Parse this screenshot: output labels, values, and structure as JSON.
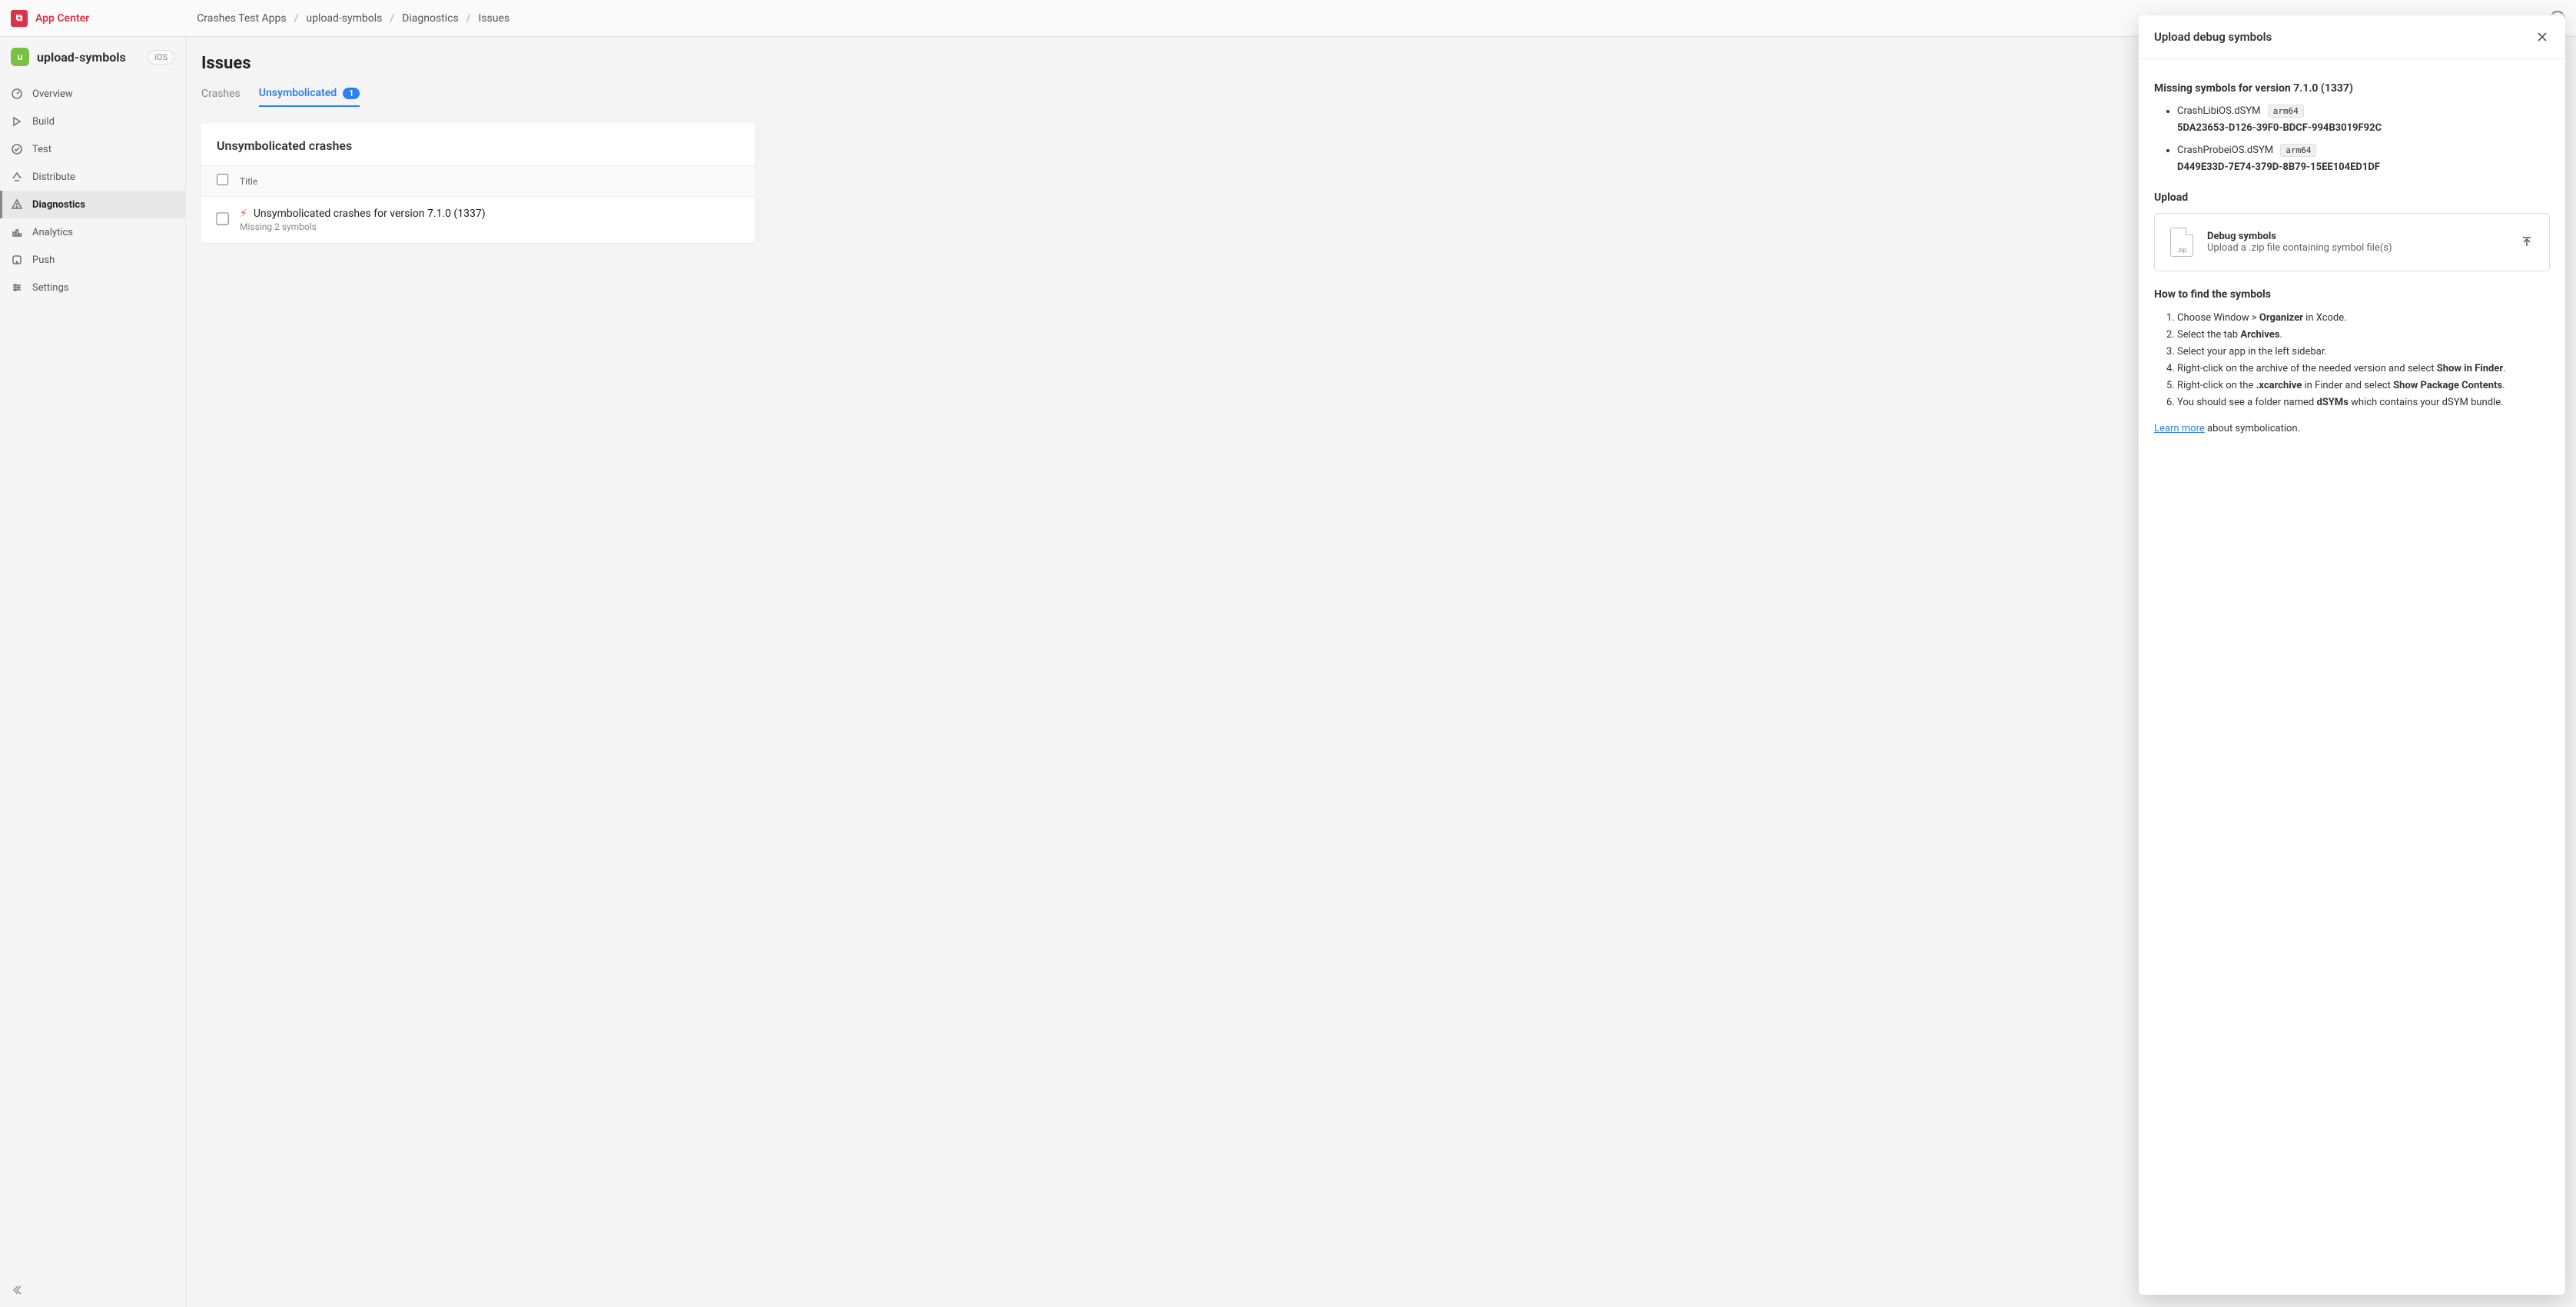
{
  "brand": {
    "logo_letter": "⧉",
    "label": "App Center"
  },
  "breadcrumbs": [
    "Crashes Test Apps",
    "upload-symbols",
    "Diagnostics",
    "Issues"
  ],
  "sidebar": {
    "app_icon_letter": "u",
    "app_name": "upload-symbols",
    "platform": "iOS",
    "items": [
      {
        "label": "Overview"
      },
      {
        "label": "Build"
      },
      {
        "label": "Test"
      },
      {
        "label": "Distribute"
      },
      {
        "label": "Diagnostics",
        "active": true
      },
      {
        "label": "Analytics"
      },
      {
        "label": "Push"
      },
      {
        "label": "Settings"
      }
    ]
  },
  "main": {
    "title": "Issues",
    "tabs": [
      {
        "label": "Crashes"
      },
      {
        "label": "Unsymbolicated",
        "active": true,
        "badge": "1"
      }
    ],
    "card_title": "Unsymbolicated crashes",
    "columns": {
      "title": "Title"
    },
    "rows": [
      {
        "title": "Unsymbolicated crashes for version 7.1.0 (1337)",
        "subtitle": "Missing 2 symbols"
      }
    ]
  },
  "panel": {
    "title": "Upload debug symbols",
    "missing_heading": "Missing symbols for version 7.1.0 (1337)",
    "symbols": [
      {
        "file": "CrashLibiOS.dSYM",
        "arch": "arm64",
        "uuid": "5DA23653-D126-39F0-BDCF-994B3019F92C"
      },
      {
        "file": "CrashProbeiOS.dSYM",
        "arch": "arm64",
        "uuid": "D449E33D-7E74-379D-8B79-15EE104ED1DF"
      }
    ],
    "upload_heading": "Upload",
    "upload_box": {
      "title": "Debug symbols",
      "subtitle": "Upload a .zip file containing symbol file(s)",
      "zip_label": ".zip"
    },
    "help_heading": "How to find the symbols",
    "help_steps": {
      "s1a": "Choose Window > ",
      "s1b": "Organizer",
      "s1c": " in Xcode.",
      "s2a": "Select the tab ",
      "s2b": "Archives",
      "s2c": ".",
      "s3": "Select your app in the left sidebar.",
      "s4a": "Right-click on the archive of the needed version and select ",
      "s4b": "Show in Finder",
      "s4c": ".",
      "s5a": "Right-click on the ",
      "s5b": ".xcarchive",
      "s5c": " in Finder and select ",
      "s5d": "Show Package Contents",
      "s5e": ".",
      "s6a": "You should see a folder named ",
      "s6b": "dSYMs",
      "s6c": " which contains your dSYM bundle."
    },
    "learn_more": "Learn more",
    "learn_suffix": " about symbolication."
  }
}
